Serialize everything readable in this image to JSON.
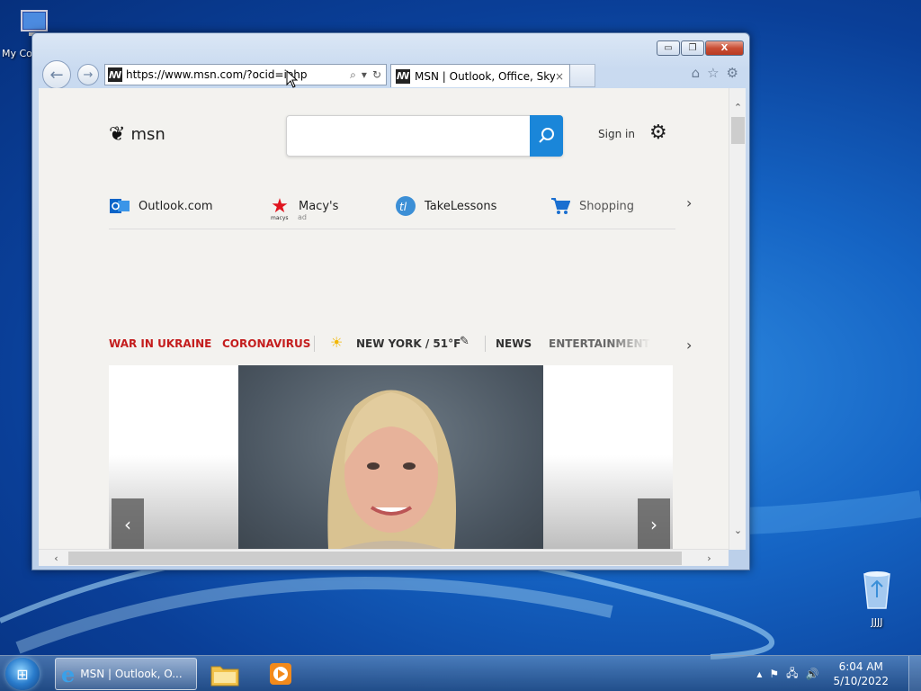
{
  "desktop": {
    "icons": [
      {
        "label": "My Co",
        "icon": "computer-icon"
      },
      {
        "label": "JJJJ",
        "icon": "recycle-bin-icon"
      }
    ]
  },
  "browser": {
    "address": {
      "url": "https://www.msn.com/?ocid=iehp",
      "favicon": "msn-favicon"
    },
    "tab": {
      "title": "MSN | Outlook, Office, Sky...",
      "close": "×"
    },
    "window_controls": {
      "minimize": "▭",
      "maximize": "❐",
      "close": "X"
    }
  },
  "page": {
    "logo_text": "msn",
    "search": {
      "placeholder": ""
    },
    "signin_label": "Sign in",
    "quick_links": [
      {
        "label": "Outlook.com",
        "sub": ""
      },
      {
        "label": "Macy's",
        "sub": "ad",
        "logo_sub": "macys"
      },
      {
        "label": "TakeLessons",
        "sub": ""
      },
      {
        "label": "Shopping",
        "sub": ""
      }
    ],
    "topics": [
      {
        "label": "WAR IN UKRAINE",
        "color": "#c41d1d"
      },
      {
        "label": "CORONAVIRUS",
        "color": "#c41d1d"
      },
      {
        "label": "NEW YORK / 51°F",
        "color": "#333333"
      },
      {
        "label": "NEWS",
        "color": "#333333"
      },
      {
        "label": "ENTERTAINMENT",
        "color": "#666666"
      }
    ],
    "accent": "#1a86d9"
  },
  "taskbar": {
    "ie_task_label": "MSN | Outlook, O...",
    "clock_time": "6:04 AM",
    "clock_date": "5/10/2022"
  }
}
